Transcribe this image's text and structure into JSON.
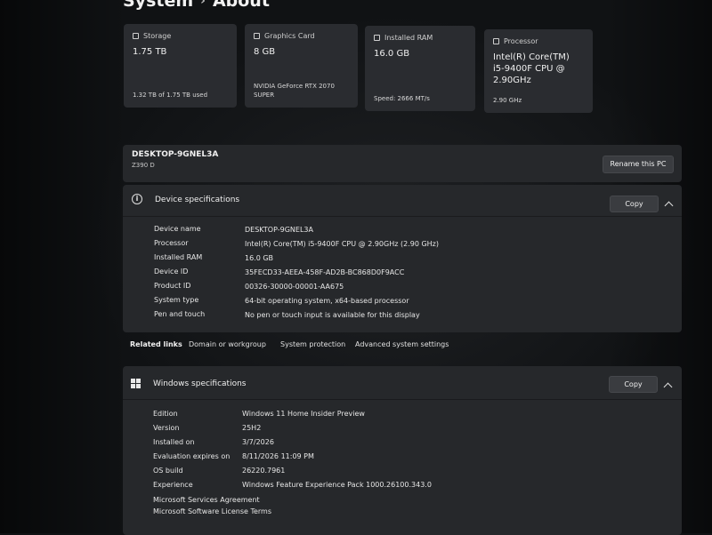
{
  "breadcrumb": {
    "parent": "System",
    "separator": "›",
    "current": "About"
  },
  "cards": {
    "storage": {
      "label": "Storage",
      "value": "1.75 TB",
      "sub": "1.32 TB of 1.75 TB used"
    },
    "graphics": {
      "label": "Graphics Card",
      "value": "8 GB",
      "sub": "NVIDIA GeForce RTX 2070 SUPER"
    },
    "ram": {
      "label": "Installed RAM",
      "value": "16.0 GB",
      "sub": "Speed: 2666 MT/s"
    },
    "processor": {
      "label": "Processor",
      "value": "Intel(R) Core(TM) i5-9400F CPU @ 2.90GHz",
      "sub": "2.90 GHz"
    }
  },
  "pc": {
    "name": "DESKTOP-9GNEL3A",
    "model": "Z390 D",
    "rename_label": "Rename this PC"
  },
  "device_specs": {
    "title": "Device specifications",
    "copy_label": "Copy",
    "rows": [
      {
        "label": "Device name",
        "value": "DESKTOP-9GNEL3A"
      },
      {
        "label": "Processor",
        "value": "Intel(R) Core(TM) i5-9400F CPU @ 2.90GHz (2.90 GHz)"
      },
      {
        "label": "Installed RAM",
        "value": "16.0 GB"
      },
      {
        "label": "Device ID",
        "value": "35FECD33-AEEA-458F-AD2B-BC868D0F9ACC"
      },
      {
        "label": "Product ID",
        "value": "00326-30000-00001-AA675"
      },
      {
        "label": "System type",
        "value": "64-bit operating system, x64-based processor"
      },
      {
        "label": "Pen and touch",
        "value": "No pen or touch input is available for this display"
      }
    ]
  },
  "related_links": {
    "title": "Related links",
    "items": [
      "Domain or workgroup",
      "System protection",
      "Advanced system settings"
    ]
  },
  "windows_specs": {
    "title": "Windows specifications",
    "copy_label": "Copy",
    "rows": [
      {
        "label": "Edition",
        "value": "Windows 11 Home Insider Preview"
      },
      {
        "label": "Version",
        "value": "25H2"
      },
      {
        "label": "Installed on",
        "value": "3/7/2026"
      },
      {
        "label": "Evaluation expires on",
        "value": "8/11/2026 11:09 PM"
      },
      {
        "label": "OS build",
        "value": "26220.7961"
      },
      {
        "label": "Experience",
        "value": "Windows Feature Experience Pack 1000.26100.343.0"
      }
    ],
    "links": [
      "Microsoft Services Agreement",
      "Microsoft Software License Terms"
    ]
  }
}
